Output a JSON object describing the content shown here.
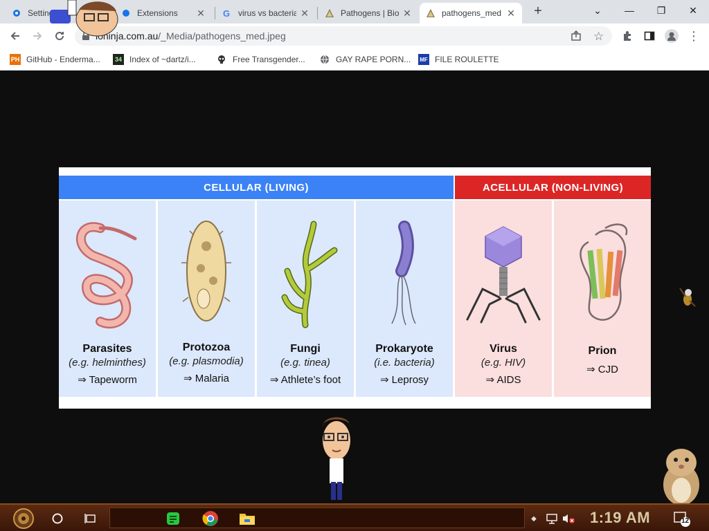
{
  "browser": {
    "tabs": [
      {
        "title": "Settings",
        "active": false
      },
      {
        "title": "Extensions",
        "active": false
      },
      {
        "title": "virus vs bacteria",
        "active": false
      },
      {
        "title": "Pathogens | Bio",
        "active": false
      },
      {
        "title": "pathogens_med",
        "active": true
      }
    ],
    "new_tab_label": "+",
    "window_buttons": {
      "menu": "⌄",
      "minimize": "—",
      "maximize": "❐",
      "close": "✕"
    },
    "url_host": "ioninja.com.au",
    "url_path": "/_Media/pathogens_med.jpeg",
    "bookmarks": [
      {
        "label": "GitHub - Enderma...",
        "icon": "ph-icon",
        "icon_text": "PH"
      },
      {
        "label": "Index of ~dartz/i...",
        "icon": "pixel-icon",
        "icon_text": "34"
      },
      {
        "label": "Free Transgender...",
        "icon": "skull-icon",
        "icon_text": ""
      },
      {
        "label": "GAY RAPE PORN...",
        "icon": "globe-icon",
        "icon_text": ""
      },
      {
        "label": "FILE ROULETTE",
        "icon": "mf-icon",
        "icon_text": "MF"
      }
    ]
  },
  "figure": {
    "cellular_header": "CELLULAR  (LIVING)",
    "acellular_header": "ACELLULAR  (NON-LIVING)",
    "panels": [
      {
        "name": "Parasites",
        "example": "(e.g. helminthes)",
        "disease": "⇒ Tapeworm"
      },
      {
        "name": "Protozoa",
        "example": "(e.g. plasmodia)",
        "disease": "⇒ Malaria"
      },
      {
        "name": "Fungi",
        "example": "(e.g. tinea)",
        "disease": "⇒ Athlete’s foot"
      },
      {
        "name": "Prokaryote",
        "example": "(i.e. bacteria)",
        "disease": "⇒ Leprosy"
      },
      {
        "name": "Virus",
        "example": "(e.g. HIV)",
        "disease": "⇒ AIDS"
      },
      {
        "name": "Prion",
        "example": "",
        "disease": "⇒ CJD"
      }
    ]
  },
  "taskbar": {
    "clock": "1:19 AM",
    "notification_count": "12"
  },
  "colors": {
    "cellular": "#3b82f6",
    "acellular": "#dc2626",
    "cell_panel": "#dce8fb",
    "acell_panel": "#fbdede"
  }
}
